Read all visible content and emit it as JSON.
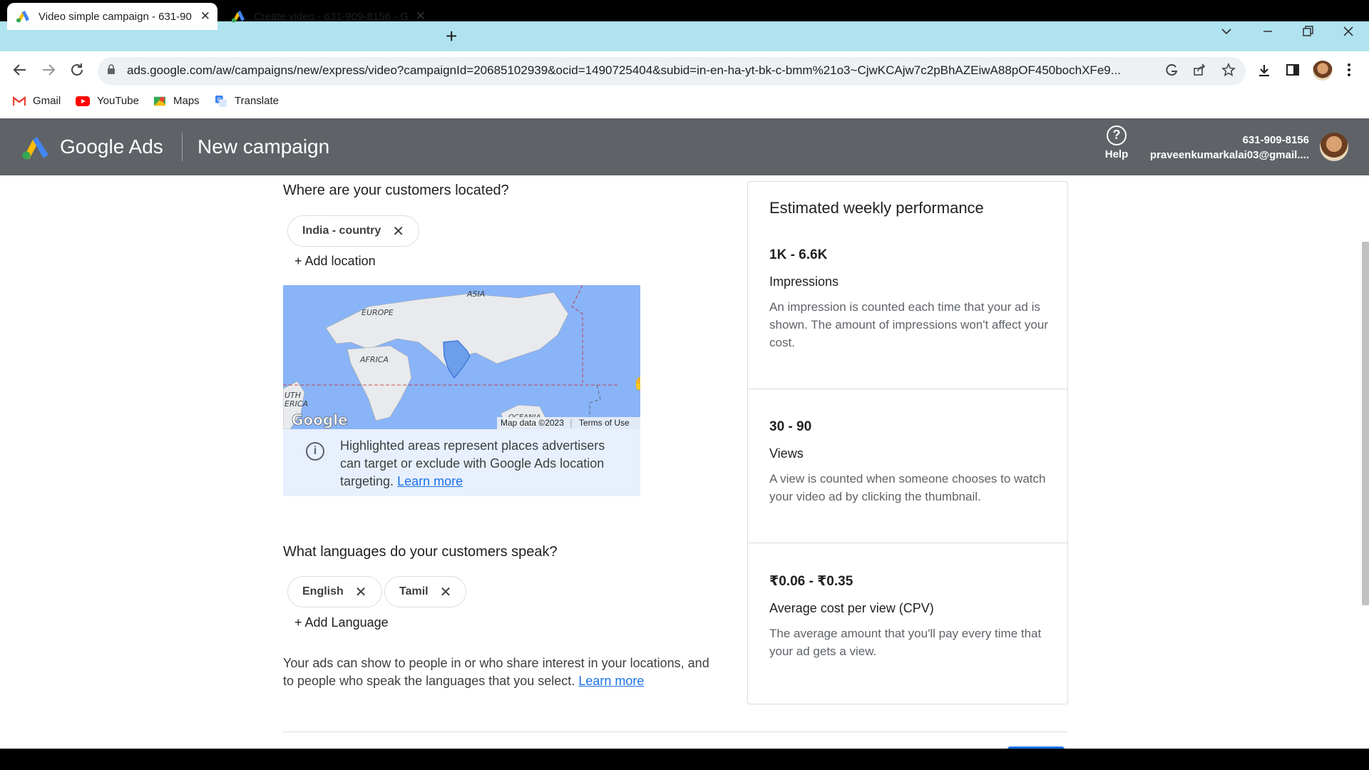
{
  "browser": {
    "tabs": [
      {
        "title": "Video simple campaign - 631-90",
        "close": "✕"
      },
      {
        "title": "Create video - 631-909-8156 - G",
        "close": "✕"
      }
    ],
    "new_tab": "+",
    "url": "ads.google.com/aw/campaigns/new/express/video?campaignId=20685102939&ocid=1490725404&subid=in-en-ha-yt-bk-c-bmm%21o3~CjwKCAjw7c2pBhAZEiwA88pOF450bochXFe9...",
    "bookmarks": [
      {
        "label": "Gmail"
      },
      {
        "label": "YouTube"
      },
      {
        "label": "Maps"
      },
      {
        "label": "Translate"
      }
    ]
  },
  "ads_header": {
    "brand": "Google Ads",
    "page_title": "New campaign",
    "help_label": "Help",
    "account_id": "631-909-8156",
    "account_email": "praveenkumarkalai03@gmail...."
  },
  "location": {
    "question": "Where are your customers located?",
    "chips": [
      {
        "label": "India - country"
      }
    ],
    "add_label": "+ Add location",
    "map": {
      "labels": [
        "ASIA",
        "EUROPE",
        "AFRICA",
        "UTH",
        "ERICA",
        "OCEANIA"
      ],
      "google_logo": "Google",
      "attribution": "Map data ©2023",
      "terms": "Terms of Use"
    },
    "info_text": "Highlighted areas represent places advertisers can target or exclude with Google Ads location targeting.",
    "info_link": "Learn more"
  },
  "languages": {
    "question": "What languages do your customers speak?",
    "chips": [
      {
        "label": "English"
      },
      {
        "label": "Tamil"
      }
    ],
    "add_label": "+ Add Language"
  },
  "footnote": {
    "text": "Your ads can show to people in or who share interest in your locations, and to people who speak the languages that you select.",
    "link": "Learn more"
  },
  "performance": {
    "title": "Estimated weekly performance",
    "metrics": [
      {
        "value": "1K - 6.6K",
        "label": "Impressions",
        "desc": "An impression is counted each time that your ad is shown. The amount of impressions won't affect your cost."
      },
      {
        "value": "30 - 90",
        "label": "Views",
        "desc": "A view is counted when someone chooses to watch your video ad by clicking the thumbnail."
      },
      {
        "value": "₹0.06 - ₹0.35",
        "label": "Average cost per view (CPV)",
        "desc": "The average amount that you'll pay every time that your ad gets a view."
      }
    ]
  },
  "colors": {
    "header_bg": "#5f6368",
    "tabstrip_bg": "#b0e3f0",
    "link": "#1a73e8",
    "map_water": "#8ab4f8"
  }
}
